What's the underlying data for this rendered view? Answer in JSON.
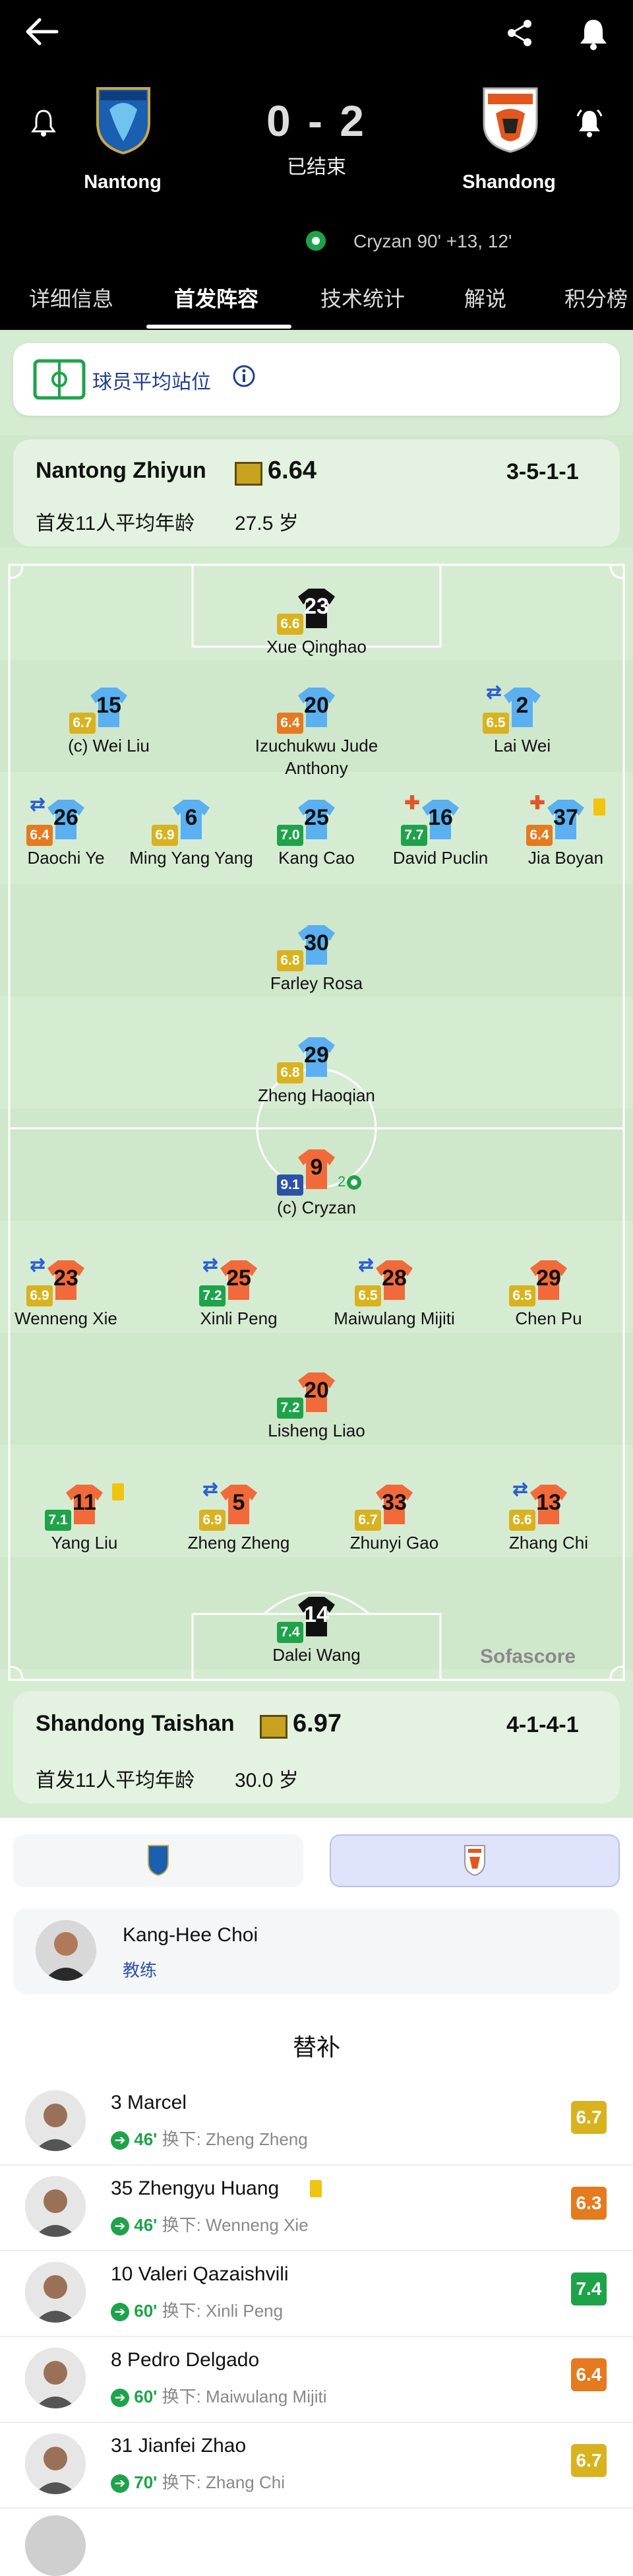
{
  "header": {
    "home_team": "Nantong",
    "away_team": "Shandong",
    "score": "0 - 2",
    "status": "已结束",
    "goal_event": "Cryzan 90' +13, 12'"
  },
  "tabs": [
    "详细信息",
    "首发阵容",
    "技术统计",
    "解说",
    "积分榜"
  ],
  "avg_positions_label": "球员平均站位",
  "home": {
    "name": "Nantong Zhiyun",
    "rating": "6.64",
    "formation": "3-5-1-1",
    "avg_age_label": "首发11人平均年龄",
    "avg_age": "27.5 岁"
  },
  "away": {
    "name": "Shandong Taishan",
    "rating": "6.97",
    "formation": "4-1-4-1",
    "avg_age_label": "首发11人平均年龄",
    "avg_age": "30.0 岁"
  },
  "home_players": [
    {
      "num": "23",
      "name": "Xue Qinghao",
      "rating": "6.6"
    },
    {
      "num": "15",
      "name": "(c) Wei Liu",
      "rating": "6.7"
    },
    {
      "num": "20",
      "name": "Izuchukwu Jude Anthony",
      "rating": "6.4"
    },
    {
      "num": "2",
      "name": "Lai Wei",
      "rating": "6.5"
    },
    {
      "num": "26",
      "name": "Daochi Ye",
      "rating": "6.4"
    },
    {
      "num": "6",
      "name": "Ming Yang Yang",
      "rating": "6.9"
    },
    {
      "num": "25",
      "name": "Kang Cao",
      "rating": "7.0"
    },
    {
      "num": "16",
      "name": "David Puclin",
      "rating": "7.7"
    },
    {
      "num": "37",
      "name": "Jia Boyan",
      "rating": "6.4"
    },
    {
      "num": "30",
      "name": "Farley Rosa",
      "rating": "6.8"
    },
    {
      "num": "29",
      "name": "Zheng Haoqian",
      "rating": "6.8"
    }
  ],
  "away_players": [
    {
      "num": "9",
      "name": "(c) Cryzan",
      "rating": "9.1",
      "goals": "2"
    },
    {
      "num": "23",
      "name": "Wenneng Xie",
      "rating": "6.9"
    },
    {
      "num": "25",
      "name": "Xinli Peng",
      "rating": "7.2"
    },
    {
      "num": "28",
      "name": "Maiwulang Mijiti",
      "rating": "6.5"
    },
    {
      "num": "29",
      "name": "Chen Pu",
      "rating": "6.5"
    },
    {
      "num": "20",
      "name": "Lisheng Liao",
      "rating": "7.2"
    },
    {
      "num": "11",
      "name": "Yang Liu",
      "rating": "7.1"
    },
    {
      "num": "5",
      "name": "Zheng Zheng",
      "rating": "6.9"
    },
    {
      "num": "33",
      "name": "Zhunyi Gao",
      "rating": "6.7"
    },
    {
      "num": "13",
      "name": "Zhang Chi",
      "rating": "6.6"
    },
    {
      "num": "14",
      "name": "Dalei Wang",
      "rating": "7.4"
    }
  ],
  "watermark": "Sofascore",
  "coach": {
    "name": "Kang-Hee Choi",
    "role": "教练"
  },
  "subs_title": "替补",
  "subs": [
    {
      "name": "3 Marcel",
      "minute": "46'",
      "replaced": "换下: Zheng Zheng",
      "rating": "6.7",
      "color": "#d9b21f"
    },
    {
      "name": "35 Zhengyu Huang",
      "minute": "46'",
      "replaced": "换下: Wenneng Xie",
      "rating": "6.3",
      "color": "#e57a1f"
    },
    {
      "name": "10 Valeri Qazaishvili",
      "minute": "60'",
      "replaced": "换下: Xinli Peng",
      "rating": "7.4",
      "color": "#1ea34a"
    },
    {
      "name": "8 Pedro Delgado",
      "minute": "60'",
      "replaced": "换下: Maiwulang Mijiti",
      "rating": "6.4",
      "color": "#e57a1f"
    },
    {
      "name": "31 Jianfei Zhao",
      "minute": "70'",
      "replaced": "换下: Zhang Chi",
      "rating": "6.7",
      "color": "#d9b21f"
    }
  ],
  "colors": {
    "home_kit": "#5ab0f0",
    "away_kit": "#f26a3a",
    "gk_kit": "#111111",
    "pitch": "#d6ecd2"
  }
}
